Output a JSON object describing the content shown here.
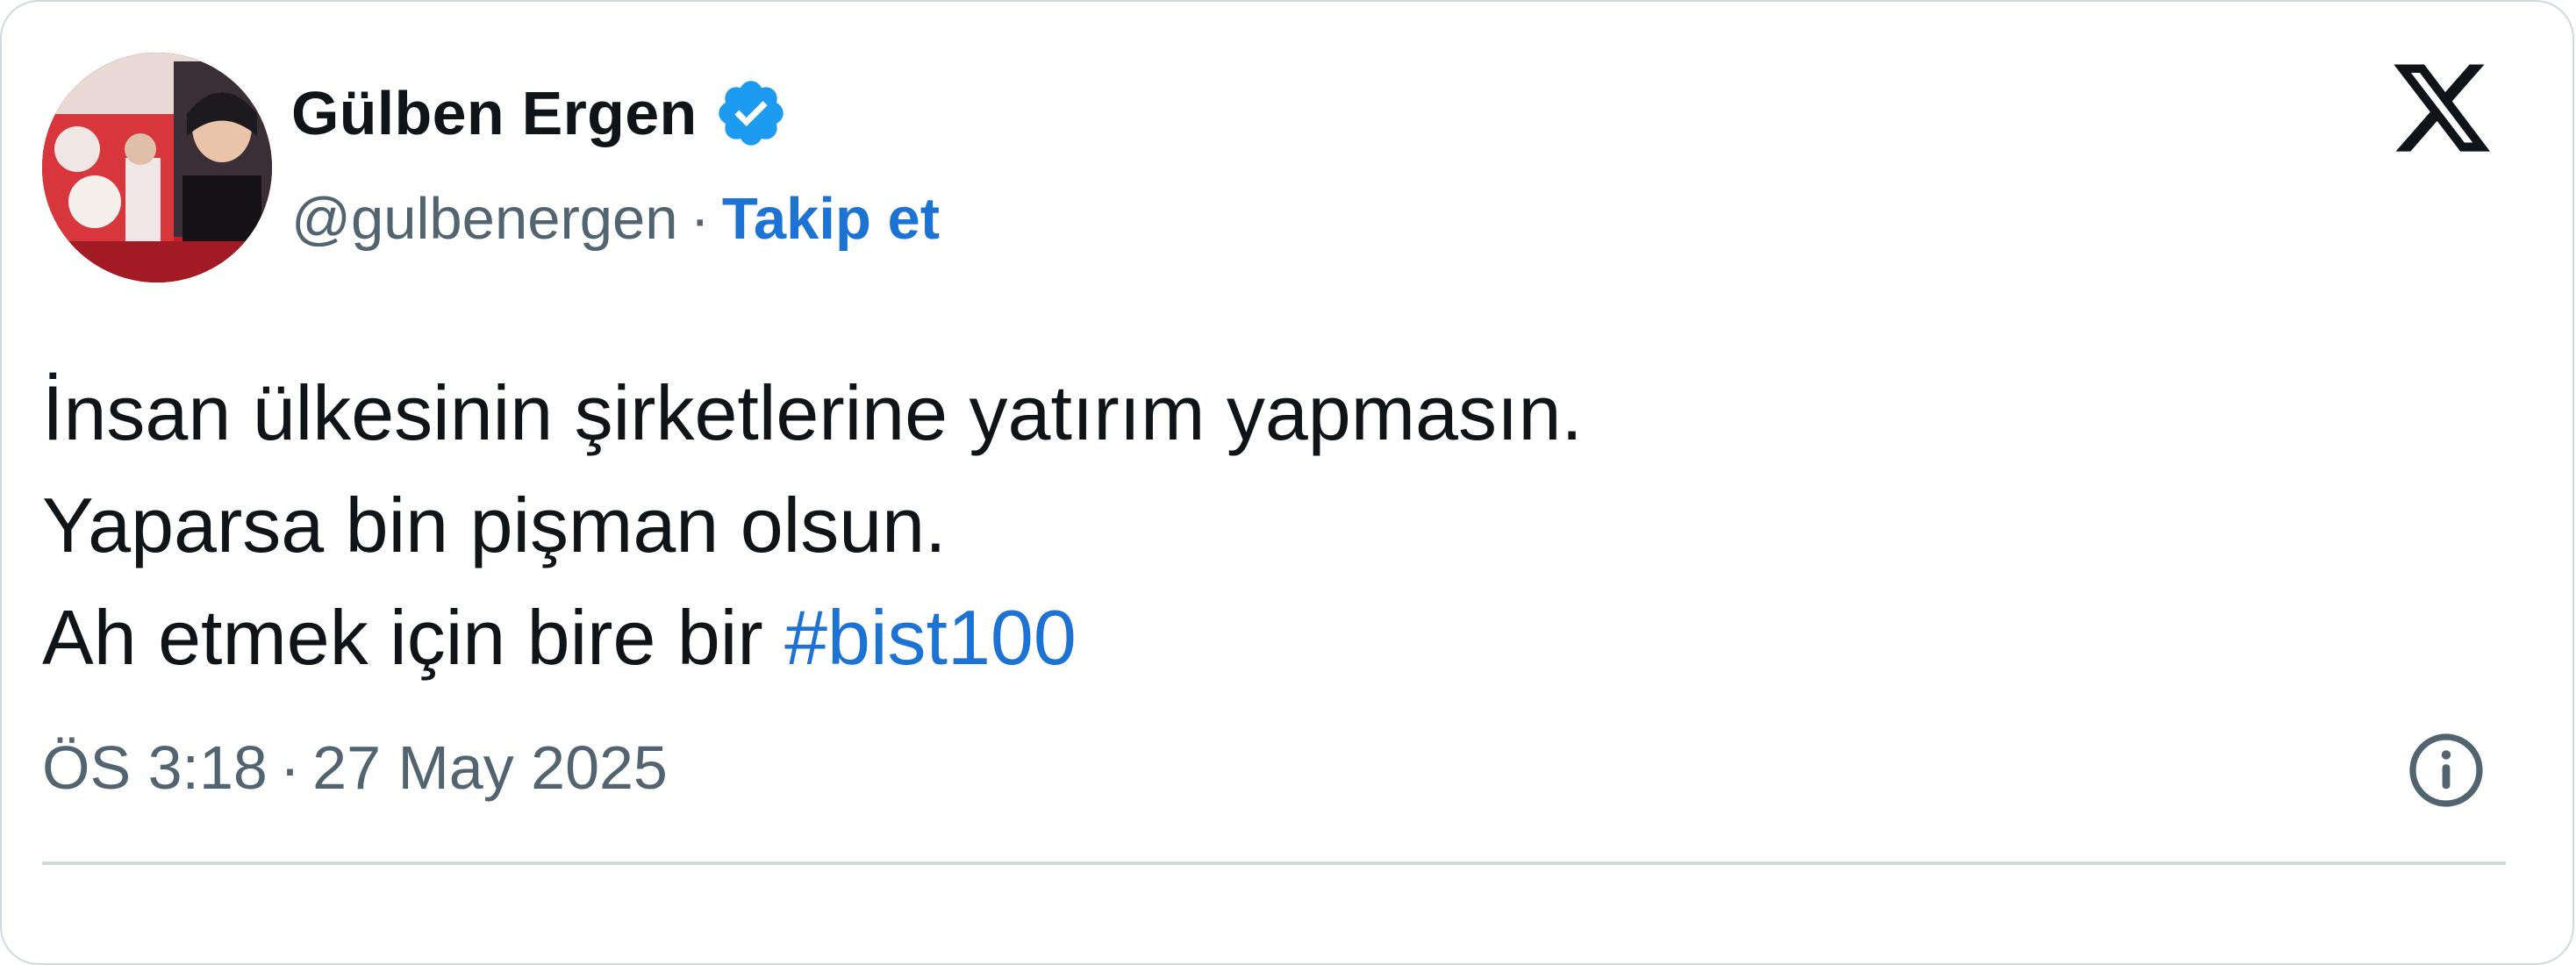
{
  "tweet": {
    "author": {
      "name": "Gülben Ergen",
      "handle": "@gulbenergen",
      "verified": true,
      "avatar": "profile-photo"
    },
    "separator": "·",
    "follow_label": "Takip et",
    "platform_icon": "x-logo-icon",
    "text_lines": [
      "İnsan ülkesinin şirketlerine yatırım yapmasın.",
      "Yaparsa bin pişman olsun.",
      "Ah etmek için bire bir "
    ],
    "hashtag": "#bist100",
    "time": "ÖS 3:18",
    "date": "27 May 2025",
    "info_icon": "info-icon"
  },
  "colors": {
    "accent": "#1d73d3",
    "verified_badge": "#1d9bf0",
    "text": "#0f1419",
    "secondary_text": "#536471",
    "border": "#cfd9de"
  }
}
